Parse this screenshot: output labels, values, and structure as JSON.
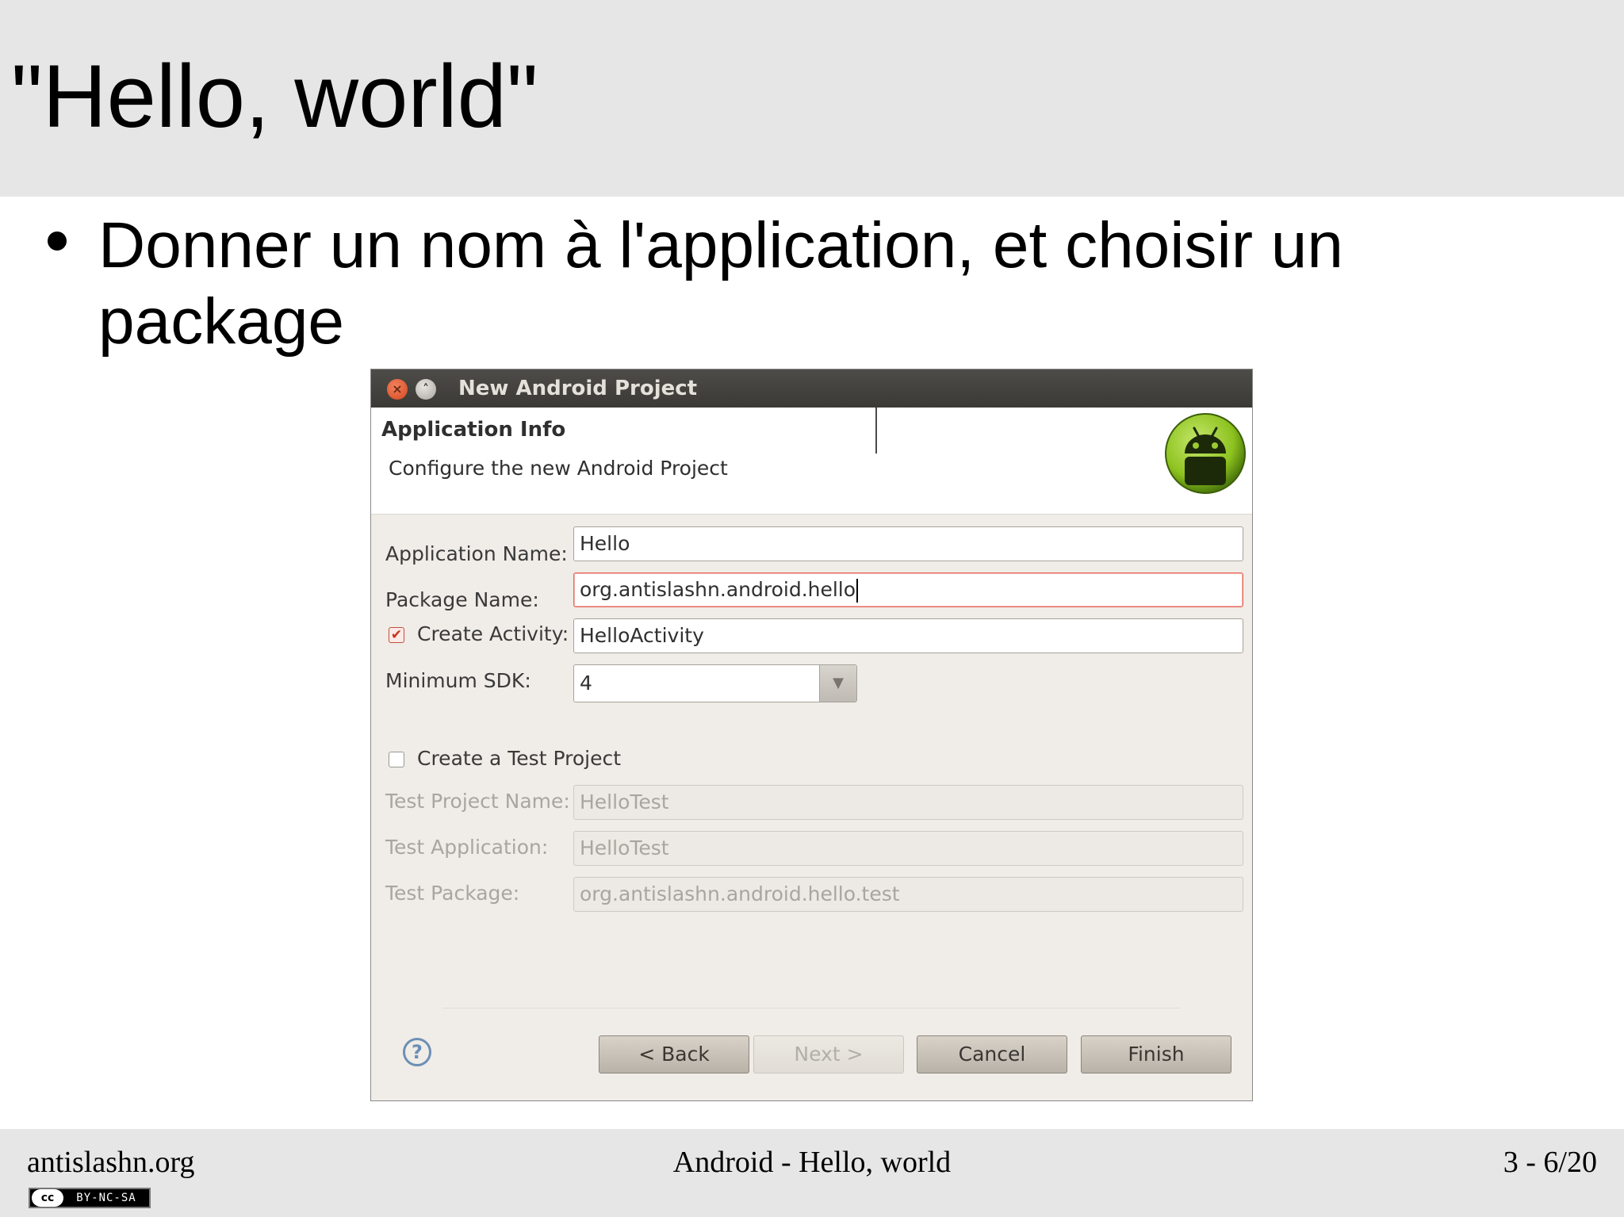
{
  "slide": {
    "title": "\"Hello, world\"",
    "bullet": "Donner un nom à l'application, et choisir un package"
  },
  "footer": {
    "left": "antislashn.org",
    "center": "Android - Hello, world",
    "right": "3 - 6/20",
    "license_logo": "cc",
    "license_text": "BY-NC-SA"
  },
  "dialog": {
    "window_title": "New Android Project",
    "window_buttons": {
      "close_symbol": "×",
      "maximize_symbol": "˄"
    },
    "header": {
      "title": "Application Info",
      "description": "Configure the new Android Project"
    },
    "form": {
      "application_name": {
        "label": "Application Name:",
        "value": "Hello"
      },
      "package_name": {
        "label": "Package Name:",
        "value": "org.antislashn.android.hello"
      },
      "create_activity": {
        "label": "Create Activity:",
        "checked": true,
        "check_symbol": "✔",
        "value": "HelloActivity"
      },
      "minimum_sdk": {
        "label": "Minimum SDK:",
        "value": "4",
        "arrow_symbol": "▼"
      },
      "create_test_project": {
        "label": "Create a Test Project",
        "checked": false
      },
      "test_project_name": {
        "label": "Test Project Name:",
        "value": "HelloTest"
      },
      "test_application": {
        "label": "Test Application:",
        "value": "HelloTest"
      },
      "test_package": {
        "label": "Test Package:",
        "value": "org.antislashn.android.hello.test"
      }
    },
    "buttons": {
      "help_symbol": "?",
      "back": "< Back",
      "next": "Next >",
      "cancel": "Cancel",
      "finish": "Finish"
    }
  },
  "colors": {
    "slide_band": "#e6e6e6",
    "titlebar": "#3a3935",
    "dialog_bg": "#f0ece7",
    "focus_border": "#e66b5e",
    "android_green": "#8dc21f"
  },
  "icons": [
    "close-icon",
    "maximize-icon",
    "android-logo-icon",
    "checkbox-checked-icon",
    "dropdown-arrow-icon",
    "help-icon",
    "creative-commons-icon"
  ]
}
